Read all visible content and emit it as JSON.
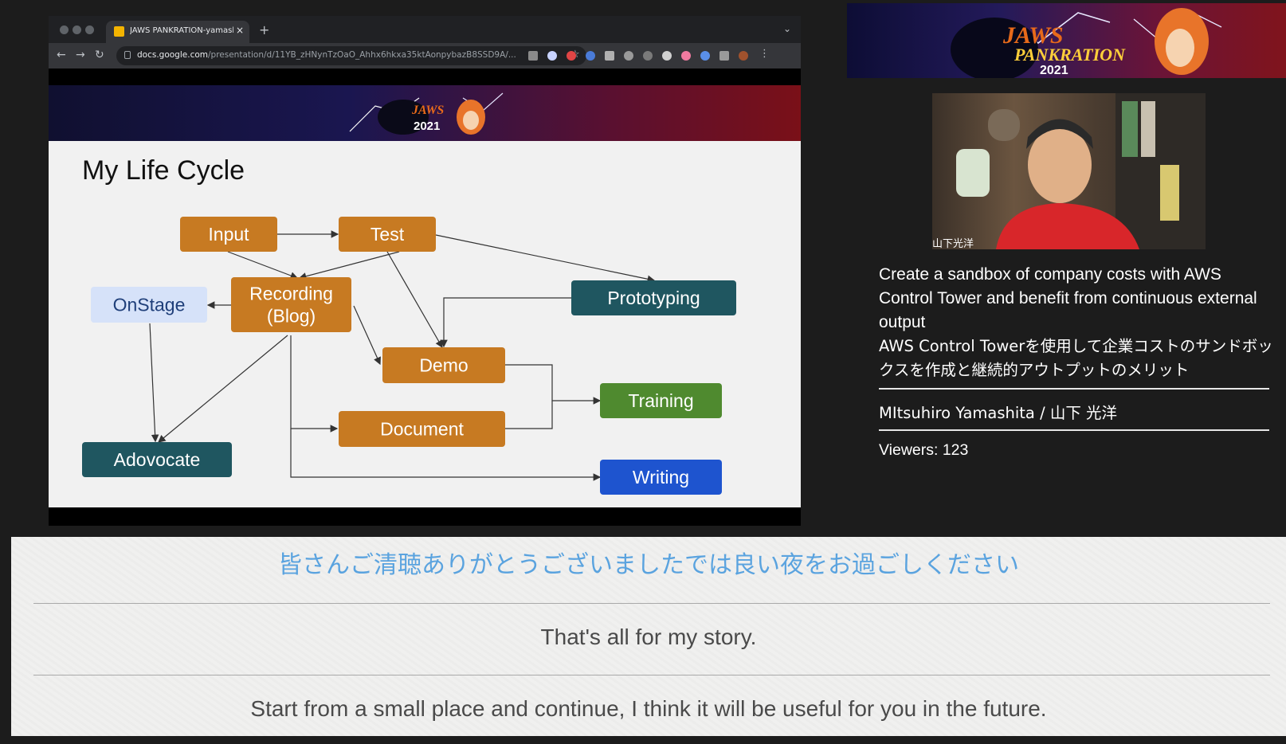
{
  "browser": {
    "tab_title": "JAWS PANKRATION-yamashita",
    "url_domain": "docs.google.com",
    "url_path": "/presentation/d/11YB_zHNynTzOaO_Ahhx6hkxa35ktAonpybazB8SSD9A/..."
  },
  "slide": {
    "title": "My Life Cycle",
    "nodes": {
      "input": "Input",
      "test": "Test",
      "recording_1": "Recording",
      "recording_2": "(Blog)",
      "onstage": "OnStage",
      "prototyping": "Prototyping",
      "demo": "Demo",
      "training": "Training",
      "document": "Document",
      "adovocate": "Adovocate",
      "writing": "Writing"
    },
    "colors": {
      "orange": "#c77a22",
      "teal": "#1f5660",
      "green": "#4f8a2f",
      "blue": "#1e54cf",
      "lightblue": "#d6e2f9"
    }
  },
  "camera": {
    "speaker_label": "山下光洋"
  },
  "talk": {
    "title_en": "Create a sandbox of company costs with AWS Control Tower and benefit from continuous external output",
    "title_ja": "AWS Control Towerを使用して企業コストのサンドボックスを作成と継続的アウトプットのメリット",
    "speaker": "MItsuhiro Yamashita / 山下 光洋",
    "viewers": "Viewers: 123"
  },
  "captions": {
    "ja": "皆さんご清聴ありがとうございましたでは良い夜をお過ごしください",
    "en_1": "That's all for my story.",
    "en_2": "Start from a small place and continue, I think it will be useful for you in the future."
  }
}
